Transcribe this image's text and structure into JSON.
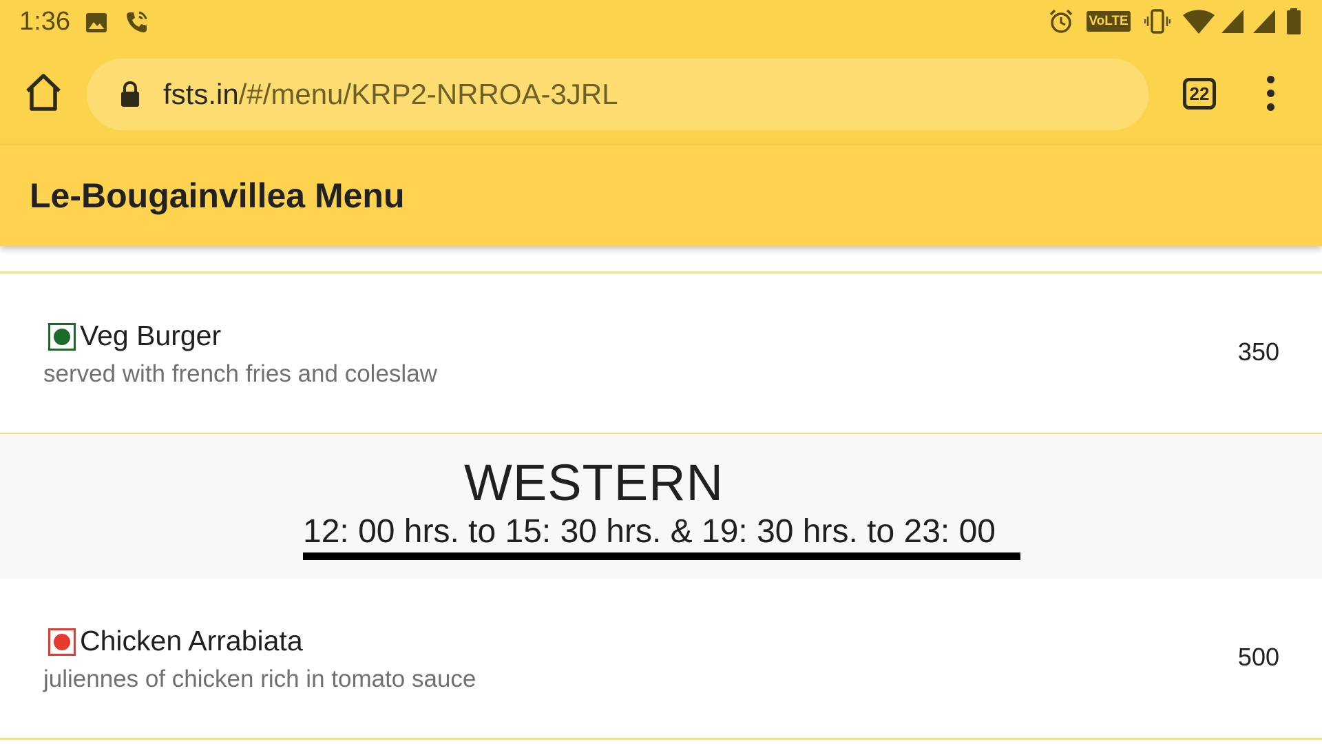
{
  "status_bar": {
    "time": "1:36",
    "icons": [
      "image-icon",
      "phone-call-icon",
      "alarm-icon",
      "volte-icon",
      "vibrate-icon",
      "wifi-icon",
      "signal-icon",
      "signal-icon",
      "battery-icon"
    ],
    "volte_label": "VoLTE"
  },
  "browser": {
    "url_host": "fsts.in",
    "url_path": "/#/menu/KRP2-NRROA-3JRL",
    "tab_count": "22",
    "toolbar_color": "#fcd34d"
  },
  "app_bar": {
    "title": "Le-Bougainvillea Menu"
  },
  "items": [
    {
      "name": "Veg Burger",
      "description": "served with french fries and coleslaw",
      "price": "350",
      "type": "veg",
      "mark_color": "#1b6b28"
    },
    {
      "name": "Chicken Arrabiata",
      "description": "juliennes of chicken rich in tomato sauce",
      "price": "500",
      "type": "non-veg",
      "mark_color": "#e63a2e"
    }
  ],
  "section": {
    "title": "WESTERN",
    "hours": "12: 00 hrs. to 15: 30 hrs. & 19: 30 hrs. to 23: 00"
  }
}
